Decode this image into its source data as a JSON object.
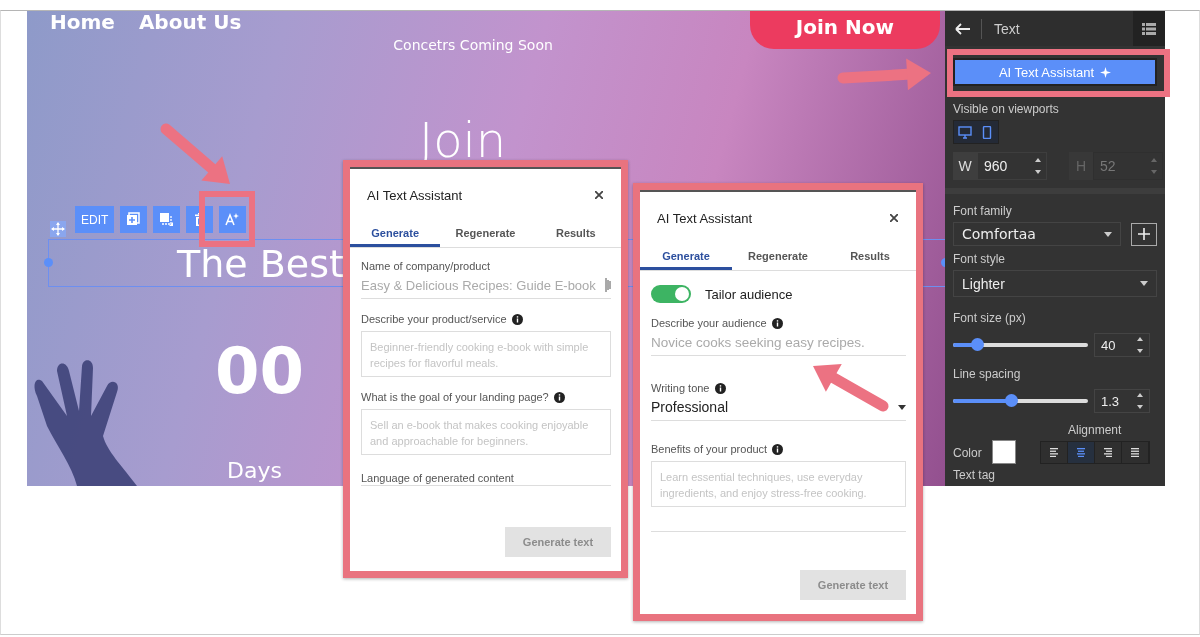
{
  "site": {
    "nav": [
      "Home",
      "About Us"
    ],
    "tagline": "Concetrs Coming Soon",
    "join_button": "Join Now",
    "hero_heading": "Join",
    "headline": "The Best",
    "countdown": {
      "value": "00",
      "unit": "Days"
    }
  },
  "element_toolbar": [
    {
      "kind": "edit",
      "label": "EDIT"
    },
    {
      "kind": "duplicate"
    },
    {
      "kind": "arrange"
    },
    {
      "kind": "delete"
    },
    {
      "kind": "ai"
    }
  ],
  "panel": {
    "title": "Text",
    "ai_button": "AI Text Assistant",
    "viewports": {
      "label": "Visible on viewports",
      "items": [
        {
          "kind": "desktop",
          "on": true
        },
        {
          "kind": "mobile",
          "on": true
        }
      ]
    },
    "width": {
      "label": "W",
      "value": "960",
      "disabled": false
    },
    "height": {
      "label": "H",
      "value": "52",
      "disabled": true
    },
    "font_family": {
      "label": "Font family",
      "value": "Comfortaa"
    },
    "font_style": {
      "label": "Font style",
      "value": "Lighter"
    },
    "font_size": {
      "label": "Font size (px)",
      "level": 0.18,
      "value": "40"
    },
    "line_spacing": {
      "label": "Line spacing",
      "level": 0.43,
      "value": "1.3"
    },
    "alignment": {
      "label": "Alignment",
      "options": [
        {
          "kind": "left",
          "selected": false
        },
        {
          "kind": "center",
          "selected": true
        },
        {
          "kind": "right",
          "selected": false
        },
        {
          "kind": "justify",
          "selected": false
        }
      ]
    },
    "color": {
      "label": "Color",
      "color": "#ffffff"
    },
    "text_tag": {
      "label": "Text tag"
    }
  },
  "dialogs": [
    {
      "title": "AI Text Assistant",
      "tabs": [
        {
          "label": "Generate",
          "selected": true
        },
        {
          "label": "Regenerate",
          "selected": false
        },
        {
          "label": "Results",
          "selected": false
        }
      ],
      "fields": [
        {
          "kind": "input",
          "label": "Name of company/product",
          "info": false,
          "placeholder": "Easy & Delicious Recipes: Guide E-book"
        },
        {
          "kind": "textarea",
          "label": "Describe your product/service",
          "info": true,
          "placeholder": "Beginner-friendly cooking e-book with simple recipes for flavorful meals."
        },
        {
          "kind": "textarea",
          "label": "What is the goal of your landing page?",
          "info": true,
          "placeholder": "Sell an e-book that makes cooking enjoyable and approachable for beginners."
        },
        {
          "kind": "heading",
          "label": "Language of generated content",
          "info": false
        }
      ],
      "button": {
        "label": "Generate text",
        "disabled": true
      }
    },
    {
      "title": "AI Text Assistant",
      "tabs": [
        {
          "label": "Generate",
          "selected": true
        },
        {
          "label": "Regenerate",
          "selected": false
        },
        {
          "label": "Results",
          "selected": false
        }
      ],
      "fields": [
        {
          "kind": "toggle",
          "label": "Tailor audience",
          "on": true
        },
        {
          "kind": "input",
          "label": "Describe your audience",
          "info": true,
          "placeholder": "Novice cooks seeking easy recipes."
        },
        {
          "kind": "select",
          "label": "Writing tone",
          "info": true,
          "value": "Professional"
        },
        {
          "kind": "textarea",
          "label": "Benefits of your product",
          "info": true,
          "placeholder": "Learn essential techniques, use everyday ingredients, and enjoy stress-free cooking."
        }
      ],
      "button": {
        "label": "Generate text",
        "disabled": true
      }
    }
  ]
}
